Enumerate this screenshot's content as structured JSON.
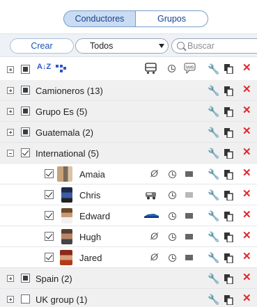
{
  "tabs": [
    {
      "label": "Conductores",
      "active": true
    },
    {
      "label": "Grupos",
      "active": false
    }
  ],
  "toolbar": {
    "create_label": "Crear",
    "filter_value": "Todos",
    "search_placeholder": "Buscar"
  },
  "header": {
    "sort_label": "A↓Z"
  },
  "groups_top": [
    {
      "label": "Camioneros (13)",
      "expanded": false,
      "checked": "partial"
    },
    {
      "label": "Grupo Es (5)",
      "expanded": false,
      "checked": "partial"
    },
    {
      "label": "Guatemala (2)",
      "expanded": false,
      "checked": "partial"
    },
    {
      "label": "International (5)",
      "expanded": true,
      "checked": "full"
    }
  ],
  "drivers": [
    {
      "name": "Amaia",
      "vehicle": "none",
      "sms_active": true
    },
    {
      "name": "Chris",
      "vehicle": "van",
      "sms_active": false
    },
    {
      "name": "Edward",
      "vehicle": "car",
      "sms_active": true
    },
    {
      "name": "Hugh",
      "vehicle": "none",
      "sms_active": true
    },
    {
      "name": "Jared",
      "vehicle": "none",
      "sms_active": true
    }
  ],
  "groups_bottom": [
    {
      "label": "Spain (2)",
      "expanded": false,
      "checked": "partial"
    },
    {
      "label": "UK group (1)",
      "expanded": false,
      "checked": "none"
    }
  ],
  "colors": {
    "accent": "#1a53b3",
    "delete": "#e0262e",
    "group_row_bg": "#f0f0f0"
  }
}
